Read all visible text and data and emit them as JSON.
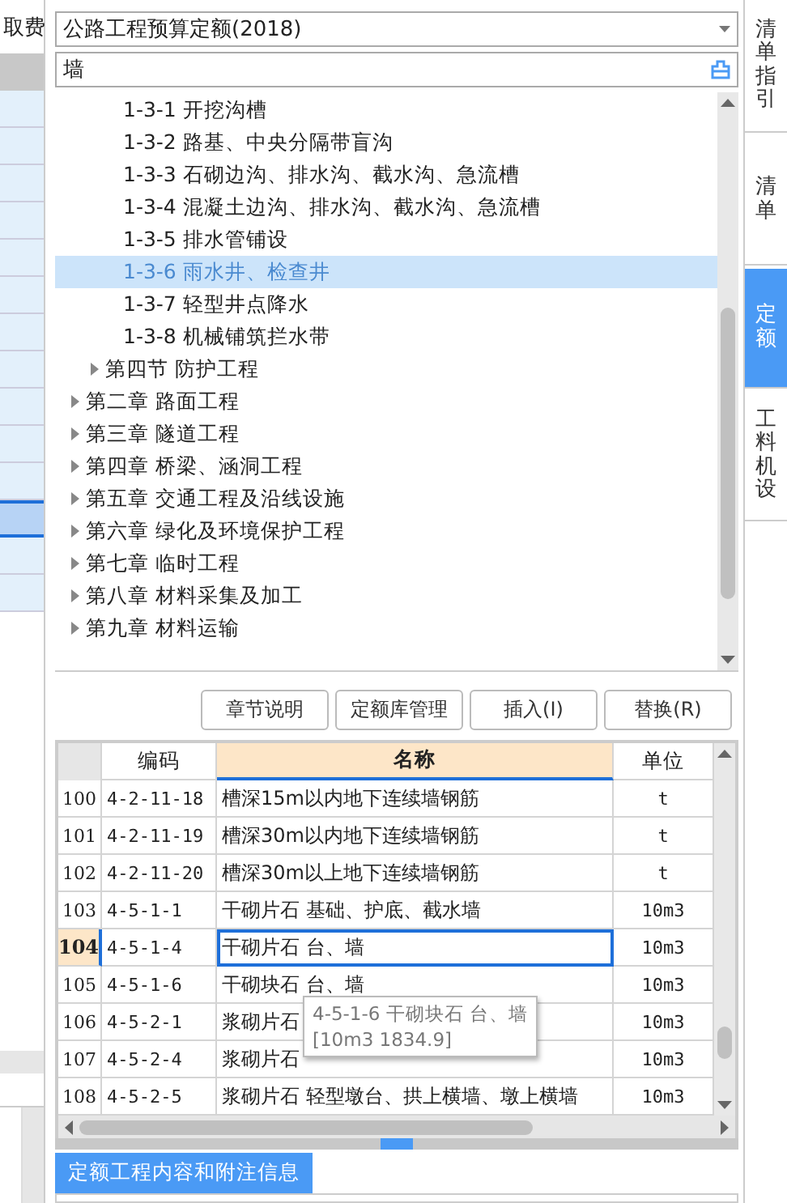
{
  "left_panel": {
    "header": "取费",
    "rows": [
      {
        "selected": false
      },
      {
        "selected": false
      },
      {
        "selected": false
      },
      {
        "selected": false
      },
      {
        "selected": false
      },
      {
        "selected": false
      },
      {
        "selected": false
      },
      {
        "selected": false
      },
      {
        "selected": false
      },
      {
        "selected": false
      },
      {
        "selected": false
      },
      {
        "selected": true
      },
      {
        "selected": false
      },
      {
        "selected": false
      }
    ]
  },
  "library_select": {
    "value": "公路工程预算定额(2018)"
  },
  "search": {
    "value": "墙"
  },
  "tree": [
    {
      "label": "1-3-1 开挖沟槽",
      "selected": false,
      "kind": "item"
    },
    {
      "label": "1-3-2 路基、中央分隔带盲沟",
      "selected": false,
      "kind": "item"
    },
    {
      "label": "1-3-3 石砌边沟、排水沟、截水沟、急流槽",
      "selected": false,
      "kind": "item"
    },
    {
      "label": "1-3-4 混凝土边沟、排水沟、截水沟、急流槽",
      "selected": false,
      "kind": "item"
    },
    {
      "label": "1-3-5 排水管铺设",
      "selected": false,
      "kind": "item"
    },
    {
      "label": "1-3-6 雨水井、检查井",
      "selected": true,
      "kind": "item"
    },
    {
      "label": "1-3-7 轻型井点降水",
      "selected": false,
      "kind": "item"
    },
    {
      "label": "1-3-8 机械铺筑拦水带",
      "selected": false,
      "kind": "item"
    },
    {
      "label": "第四节 防护工程",
      "selected": false,
      "kind": "section",
      "expanded": false
    },
    {
      "label": "第二章 路面工程",
      "selected": false,
      "kind": "chapter",
      "expanded": false
    },
    {
      "label": "第三章 隧道工程",
      "selected": false,
      "kind": "chapter",
      "expanded": false
    },
    {
      "label": "第四章 桥梁、涵洞工程",
      "selected": false,
      "kind": "chapter",
      "expanded": false
    },
    {
      "label": "第五章 交通工程及沿线设施",
      "selected": false,
      "kind": "chapter",
      "expanded": false
    },
    {
      "label": "第六章 绿化及环境保护工程",
      "selected": false,
      "kind": "chapter",
      "expanded": false
    },
    {
      "label": "第七章 临时工程",
      "selected": false,
      "kind": "chapter",
      "expanded": false
    },
    {
      "label": "第八章 材料采集及加工",
      "selected": false,
      "kind": "chapter",
      "expanded": false
    },
    {
      "label": "第九章 材料运输",
      "selected": false,
      "kind": "chapter",
      "expanded": false
    }
  ],
  "buttons": [
    "章节说明",
    "定额库管理",
    "插入(I)",
    "替换(R)"
  ],
  "table": {
    "columns": [
      "编码",
      "名称",
      "单位"
    ],
    "rows": [
      {
        "no": "100",
        "code": "4-2-11-18",
        "name": "槽深15m以内地下连续墙钢筋",
        "unit": "t",
        "selected": false
      },
      {
        "no": "101",
        "code": "4-2-11-19",
        "name": "槽深30m以内地下连续墙钢筋",
        "unit": "t",
        "selected": false
      },
      {
        "no": "102",
        "code": "4-2-11-20",
        "name": "槽深30m以上地下连续墙钢筋",
        "unit": "t",
        "selected": false
      },
      {
        "no": "103",
        "code": "4-5-1-1",
        "name": "干砌片石 基础、护底、截水墙",
        "unit": "10m3",
        "selected": false
      },
      {
        "no": "104",
        "code": "4-5-1-4",
        "name": "干砌片石 台、墙",
        "unit": "10m3",
        "selected": true
      },
      {
        "no": "105",
        "code": "4-5-1-6",
        "name": "干砌块石 台、墙",
        "unit": "10m3",
        "selected": false
      },
      {
        "no": "106",
        "code": "4-5-2-1",
        "name": "浆砌片石",
        "unit": "10m3",
        "selected": false
      },
      {
        "no": "107",
        "code": "4-5-2-4",
        "name": "浆砌片石",
        "unit": "10m3",
        "selected": false
      },
      {
        "no": "108",
        "code": "4-5-2-5",
        "name": "浆砌片石 轻型墩台、拱上横墙、墩上横墙",
        "unit": "10m3",
        "selected": false
      }
    ]
  },
  "tooltip": {
    "line_1": "4-5-1-6 干砌块石 台、墙",
    "line_2": "[10m3 1834.9]"
  },
  "bottom_tab": {
    "label": "定额工程内容和附注信息"
  },
  "side_tabs": [
    {
      "label": "清单指引",
      "selected": false
    },
    {
      "label": "清单",
      "selected": false
    },
    {
      "label": "定额",
      "selected": true
    },
    {
      "label": "工料机设",
      "selected": false
    }
  ]
}
